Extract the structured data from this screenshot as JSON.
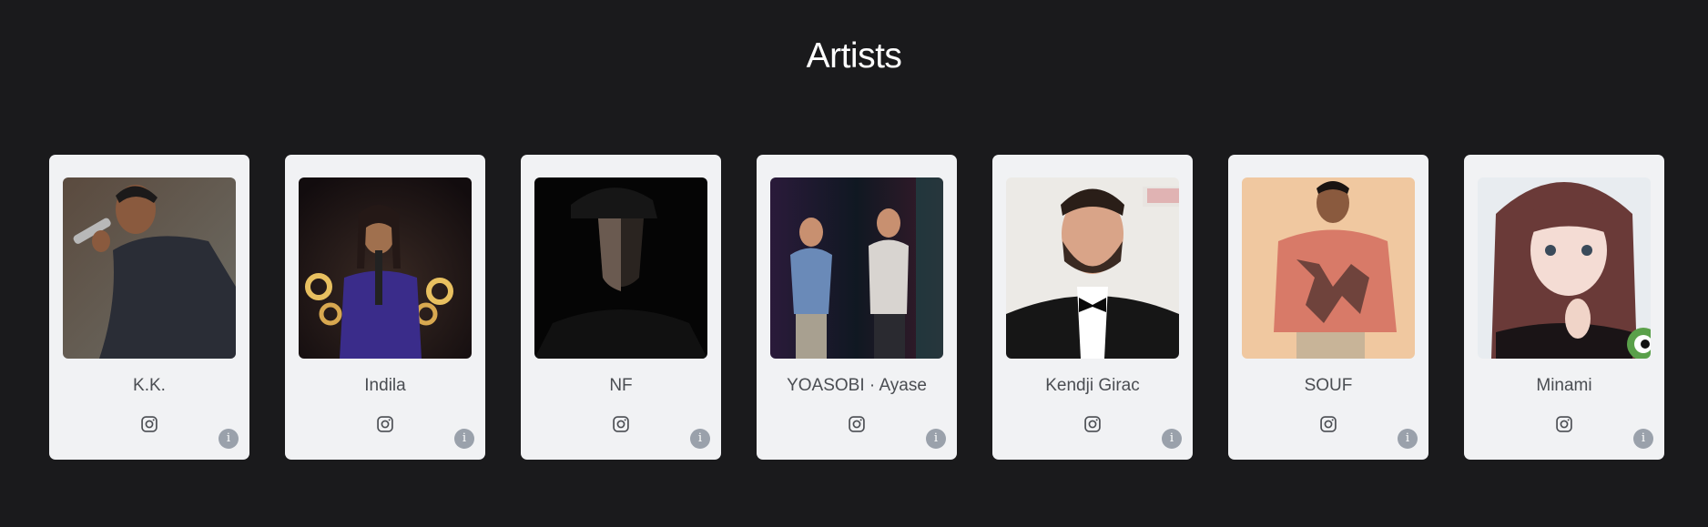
{
  "page": {
    "title": "Artists"
  },
  "artists": [
    {
      "name": "K.K."
    },
    {
      "name": "Indila"
    },
    {
      "name": "NF"
    },
    {
      "name": "YOASOBI · Ayase"
    },
    {
      "name": "Kendji Girac"
    },
    {
      "name": "SOUF"
    },
    {
      "name": "Minami"
    }
  ],
  "icons": {
    "social": "instagram-icon",
    "info": "info-icon",
    "info_glyph": "i"
  },
  "colors": {
    "background": "#1a1a1c",
    "card": "#f1f2f4",
    "name_text": "#4a4d52",
    "info_badge": "#9aa1ab"
  }
}
